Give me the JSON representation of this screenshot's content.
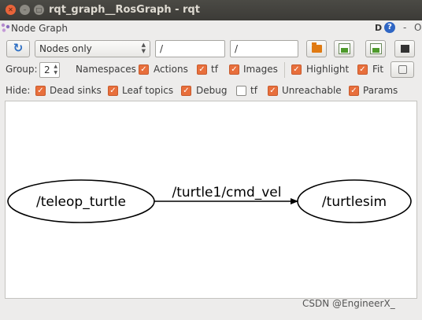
{
  "window": {
    "title": "rqt_graph__RosGraph - rqt"
  },
  "plugin": {
    "title": "Node Graph",
    "d_label": "D",
    "help_label": "?",
    "minimize_label": "-",
    "close_label": "O"
  },
  "toolbar": {
    "mode_value": "Nodes only",
    "filter_value": "/",
    "filter2_value": "/"
  },
  "options": {
    "group_label": "Group:",
    "group_value": "2",
    "namespaces_label": "Namespaces",
    "actions_label": "Actions",
    "tf_label": "tf",
    "images_label": "Images",
    "highlight_label": "Highlight",
    "fit_label": "Fit"
  },
  "hide": {
    "label": "Hide:",
    "dead_sinks_label": "Dead sinks",
    "leaf_topics_label": "Leaf topics",
    "debug_label": "Debug",
    "tf_label": "tf",
    "unreachable_label": "Unreachable",
    "params_label": "Params"
  },
  "checkbox_states": {
    "actions": true,
    "tf": true,
    "images": true,
    "highlight": true,
    "fit": true,
    "dead_sinks": true,
    "leaf_topics": true,
    "debug": true,
    "hide_tf": false,
    "unreachable": true,
    "params": true
  },
  "graph": {
    "nodes": [
      {
        "id": "teleop",
        "label": "/teleop_turtle"
      },
      {
        "id": "turtlesim",
        "label": "/turtlesim"
      }
    ],
    "edges": [
      {
        "from": "teleop",
        "to": "turtlesim",
        "label": "/turtle1/cmd_vel"
      }
    ]
  },
  "watermark": "CSDN @EngineerX_",
  "colors": {
    "checkbox": "#e86f3c",
    "titlebar": "#3c3b37",
    "close_button": "#e9643a"
  },
  "icons": [
    "refresh-icon",
    "folder-open-icon",
    "save-dot-icon",
    "save-image-icon",
    "stop-icon",
    "fit-icon",
    "help-icon"
  ]
}
